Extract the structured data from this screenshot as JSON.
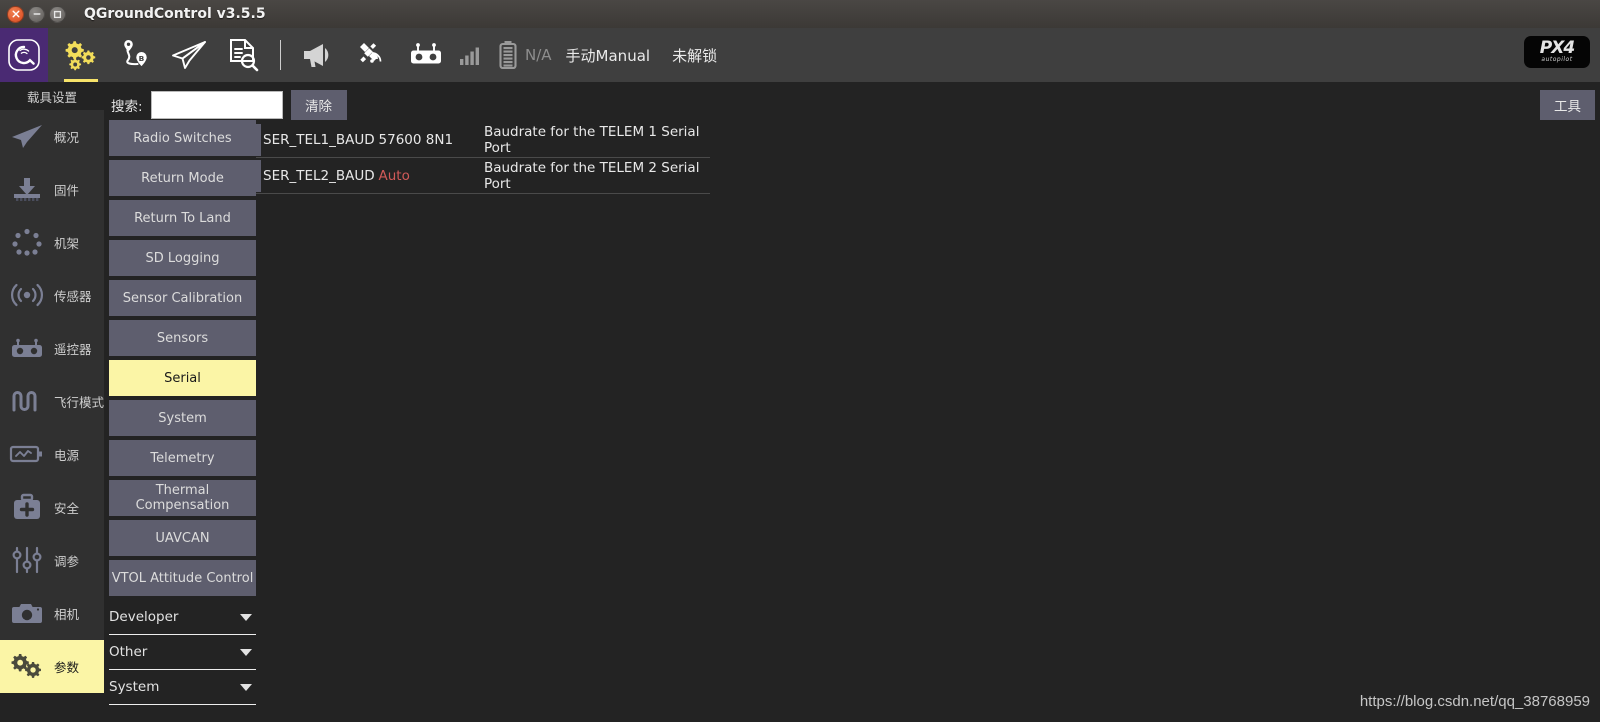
{
  "window": {
    "title": "QGroundControl v3.5.5",
    "controls": [
      "close-button",
      "minimize-button",
      "maximize-button"
    ]
  },
  "toolbar": {
    "logo": "qgc-logo",
    "icons": [
      {
        "name": "settings-gears-icon",
        "active": true
      },
      {
        "name": "plan-route-icon",
        "active": false
      },
      {
        "name": "fly-paper-plane-icon",
        "active": false
      },
      {
        "name": "analyze-document-icon",
        "active": false
      },
      {
        "name": "messages-megaphone-icon",
        "active": false
      },
      {
        "name": "gps-satellite-icon",
        "active": false
      },
      {
        "name": "rc-controller-icon",
        "active": false
      },
      {
        "name": "signal-strength-icon",
        "active": false
      },
      {
        "name": "battery-icon",
        "active": false
      }
    ],
    "battery_value": "N/A",
    "flight_mode": "手动Manual",
    "arm_state": "未解锁",
    "px4_logo_main": "PX4",
    "px4_logo_sub": "autopilot"
  },
  "sidebar": {
    "title": "载具设置",
    "items": [
      {
        "label": "概况",
        "icon": "summary-plane-icon",
        "selected": false
      },
      {
        "label": "固件",
        "icon": "firmware-download-icon",
        "selected": false
      },
      {
        "label": "机架",
        "icon": "airframe-dots-icon",
        "selected": false
      },
      {
        "label": "传感器",
        "icon": "sensors-waves-icon",
        "selected": false
      },
      {
        "label": "遥控器",
        "icon": "radio-controller-icon",
        "selected": false
      },
      {
        "label": "飞行模式",
        "icon": "flight-modes-icon",
        "selected": false
      },
      {
        "label": "电源",
        "icon": "power-battery-icon",
        "selected": false
      },
      {
        "label": "安全",
        "icon": "safety-kit-icon",
        "selected": false
      },
      {
        "label": "调参",
        "icon": "tuning-sliders-icon",
        "selected": false
      },
      {
        "label": "相机",
        "icon": "camera-icon",
        "selected": false
      },
      {
        "label": "参数",
        "icon": "parameters-gears-icon",
        "selected": true
      }
    ]
  },
  "search": {
    "label": "搜索:",
    "value": "",
    "placeholder": "",
    "clear_label": "清除"
  },
  "tools": {
    "label": "工具"
  },
  "groups": {
    "buttons": [
      {
        "label": "Radio Switches",
        "selected": false
      },
      {
        "label": "Return Mode",
        "selected": false
      },
      {
        "label": "Return To Land",
        "selected": false
      },
      {
        "label": "SD Logging",
        "selected": false
      },
      {
        "label": "Sensor Calibration",
        "selected": false
      },
      {
        "label": "Sensors",
        "selected": false
      },
      {
        "label": "Serial",
        "selected": true
      },
      {
        "label": "System",
        "selected": false
      },
      {
        "label": "Telemetry",
        "selected": false
      },
      {
        "label": "Thermal Compensation",
        "selected": false
      },
      {
        "label": "UAVCAN",
        "selected": false
      },
      {
        "label": "VTOL Attitude Control",
        "selected": false
      }
    ],
    "sections": [
      {
        "label": "Developer",
        "expanded": false
      },
      {
        "label": "Other",
        "expanded": false
      },
      {
        "label": "System",
        "expanded": false
      }
    ]
  },
  "parameters": {
    "rows": [
      {
        "name": "SER_TEL1_BAUD",
        "value": "57600 8N1",
        "modified": false,
        "description": "Baudrate for the TELEM 1 Serial Port"
      },
      {
        "name": "SER_TEL2_BAUD",
        "value": "Auto",
        "modified": true,
        "description": "Baudrate for the TELEM 2 Serial Port"
      }
    ]
  },
  "watermark": "https://blog.csdn.net/qq_38768959",
  "colors": {
    "accent_yellow": "#fbf5a6",
    "toolbar_bg": "#3f3f3f",
    "body_bg": "#232323",
    "button_gray": "#5e5e6e",
    "modified_red": "#d05a58",
    "qgc_purple": "#4a2a73"
  }
}
